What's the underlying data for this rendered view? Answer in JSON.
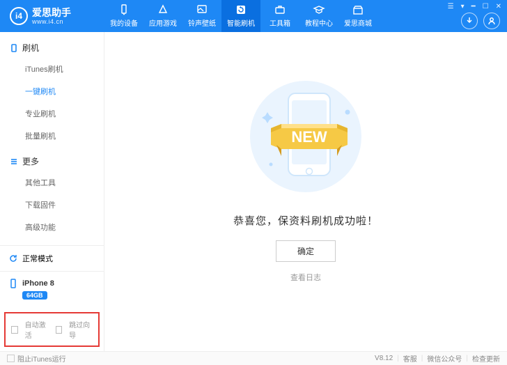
{
  "brand": {
    "title": "爱思助手",
    "url": "www.i4.cn"
  },
  "tabs": [
    {
      "label": "我的设备"
    },
    {
      "label": "应用游戏"
    },
    {
      "label": "铃声壁纸"
    },
    {
      "label": "智能刷机"
    },
    {
      "label": "工具箱"
    },
    {
      "label": "教程中心"
    },
    {
      "label": "爱思商城"
    }
  ],
  "sidebar": {
    "sec1": {
      "title": "刷机",
      "items": [
        "iTunes刷机",
        "一键刷机",
        "专业刷机",
        "批量刷机"
      ]
    },
    "sec2": {
      "title": "更多",
      "items": [
        "其他工具",
        "下载固件",
        "高级功能"
      ]
    }
  },
  "mode": "正常模式",
  "device": {
    "name": "iPhone 8",
    "storage": "64GB"
  },
  "checks": {
    "auto": "自动激活",
    "skip": "跳过向导"
  },
  "main": {
    "illus_text": "NEW",
    "success": "恭喜您，保资料刷机成功啦！",
    "confirm": "确定",
    "log": "查看日志"
  },
  "footer": {
    "block": "阻止iTunes运行",
    "version": "V8.12",
    "svc": "客服",
    "wx": "微信公众号",
    "upd": "检查更新"
  }
}
